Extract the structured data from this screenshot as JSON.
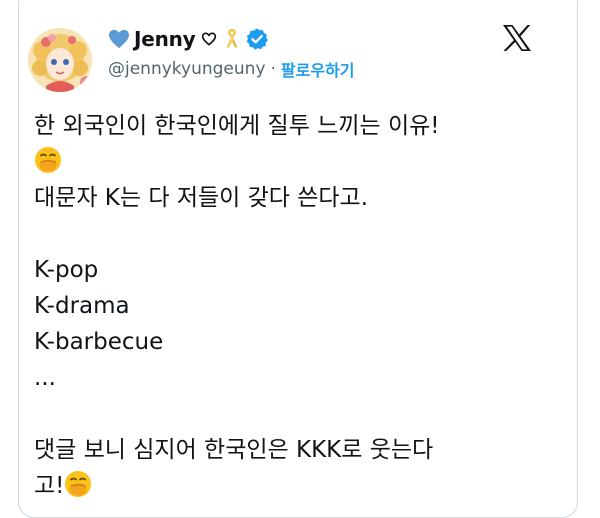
{
  "author": {
    "display_name": "Jenny",
    "handle": "@jennykyungeuny",
    "separator": "·",
    "follow_label": "팔로우하기"
  },
  "icons": {
    "name_prefix": "blue-heart-icon",
    "name_suffix": "outline-heart-icon",
    "ribbon": "yellow-ribbon-icon",
    "verified": "verified-badge-icon",
    "platform": "x-logo-icon",
    "emoji": "face-with-hand-over-mouth-emoji"
  },
  "colors": {
    "accent": "#1d9bf0",
    "secondary_text": "#536471",
    "text": "#0f1419",
    "ribbon": "#f2c94c"
  },
  "tweet": {
    "line1": "한 외국인이 한국인에게 질투 느끼는 이유!",
    "line2": "대문자 K는 다 저들이 갖다 쓴다고.",
    "list": [
      "K-pop",
      "K-drama",
      "K-barbecue",
      "..."
    ],
    "line3": "댓글 보니 심지어 한국인은 KKK로 웃는다",
    "line4": "고!"
  }
}
